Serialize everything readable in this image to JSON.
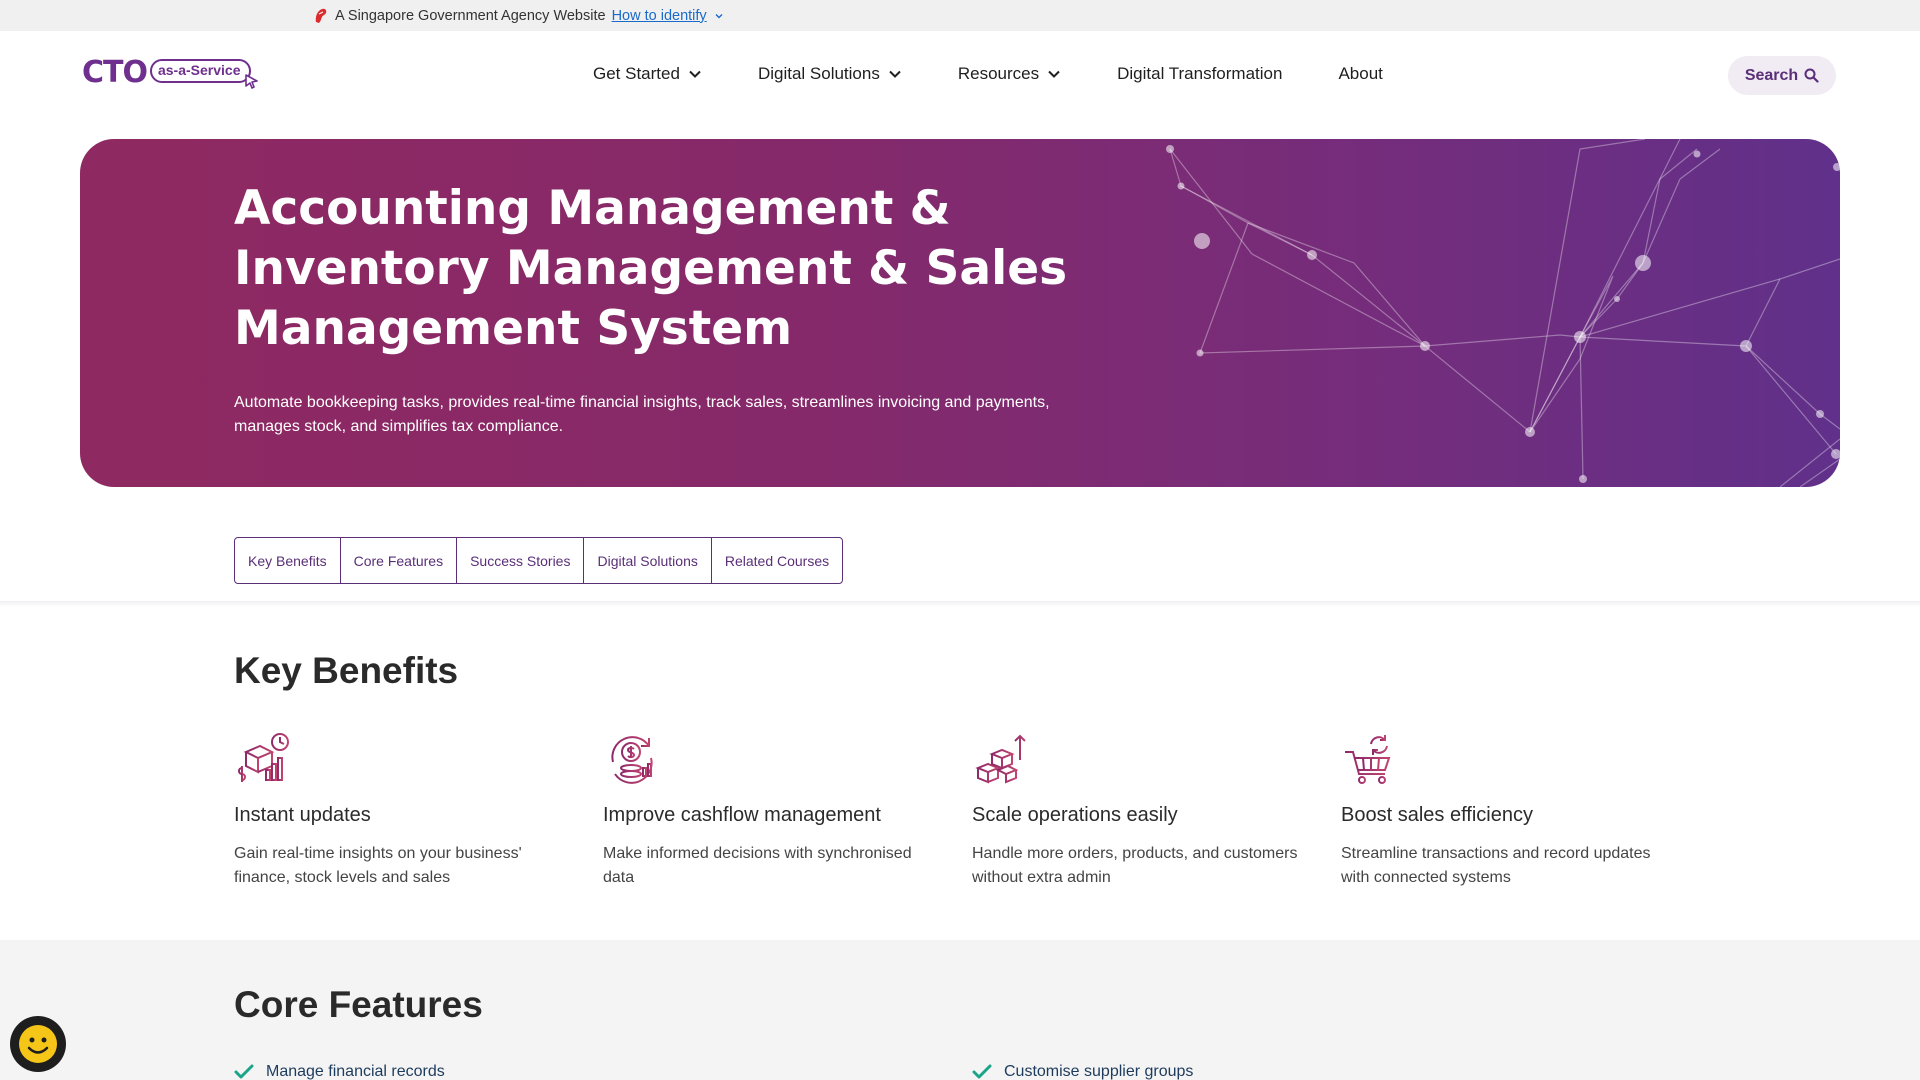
{
  "masthead": {
    "text": "A Singapore Government Agency Website",
    "link": "How to identify"
  },
  "header": {
    "logo_main": "CTO",
    "logo_pill": "as-a-Service",
    "nav": [
      {
        "label": "Get Started",
        "has_dropdown": true
      },
      {
        "label": "Digital Solutions",
        "has_dropdown": true
      },
      {
        "label": "Resources",
        "has_dropdown": true
      },
      {
        "label": "Digital Transformation",
        "has_dropdown": false
      },
      {
        "label": "About",
        "has_dropdown": false
      }
    ],
    "search_label": "Search"
  },
  "hero": {
    "title": "Accounting Management & Inventory Management & Sales Management System",
    "description": "Automate bookkeeping tasks, provides real-time financial insights, track sales, streamlines invoicing and payments, manages stock, and simplifies tax compliance."
  },
  "tabs": [
    "Key Benefits",
    "Core Features",
    "Success Stories",
    "Digital Solutions",
    "Related Courses"
  ],
  "key_benefits": {
    "title": "Key Benefits",
    "items": [
      {
        "icon": "boxes-chart-clock-icon",
        "title": "Instant updates",
        "desc": "Gain real-time insights on your business' finance, stock levels and sales"
      },
      {
        "icon": "dollar-coin-cycle-icon",
        "title": "Improve cashflow management",
        "desc": "Make informed decisions with synchronised data"
      },
      {
        "icon": "stacked-boxes-growth-icon",
        "title": "Scale operations easily",
        "desc": "Handle more orders, products, and customers without extra admin"
      },
      {
        "icon": "cart-refresh-icon",
        "title": "Boost sales efficiency",
        "desc": "Streamline transactions and record updates with connected systems"
      }
    ]
  },
  "core_features": {
    "title": "Core Features",
    "items": [
      "Manage financial records",
      "Customise supplier groups"
    ]
  },
  "colors": {
    "brand_purple": "#6e2f8e",
    "hero_start": "#8f2961",
    "hero_end": "#60308a",
    "link_blue": "#1a6ac9",
    "check_teal": "#1aa589"
  }
}
